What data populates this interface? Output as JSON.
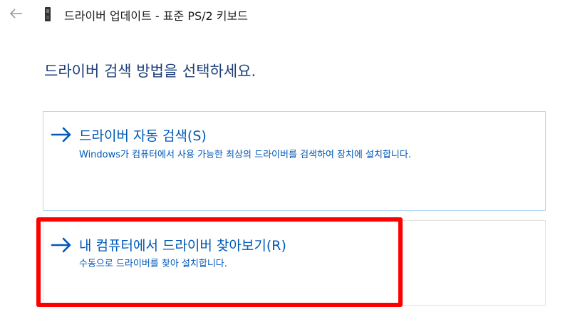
{
  "window": {
    "title": "드라이버 업데이트 - 표준 PS/2 키보드",
    "back_icon": "back-arrow-icon",
    "device_icon": "keyboard-device-icon"
  },
  "heading": "드라이버 검색 방법을 선택하세요.",
  "options": [
    {
      "title": "드라이버 자동 검색(S)",
      "description": "Windows가 컴퓨터에서 사용 가능한 최상의 드라이버를 검색하여 장치에 설치합니다.",
      "icon": "right-arrow-icon"
    },
    {
      "title": "내 컴퓨터에서 드라이버 찾아보기(R)",
      "description": "수동으로 드라이버를 찾아 설치합니다.",
      "icon": "right-arrow-icon"
    }
  ],
  "colors": {
    "heading": "#1e3f78",
    "link": "#0059b8",
    "highlight": "#ff0000"
  }
}
